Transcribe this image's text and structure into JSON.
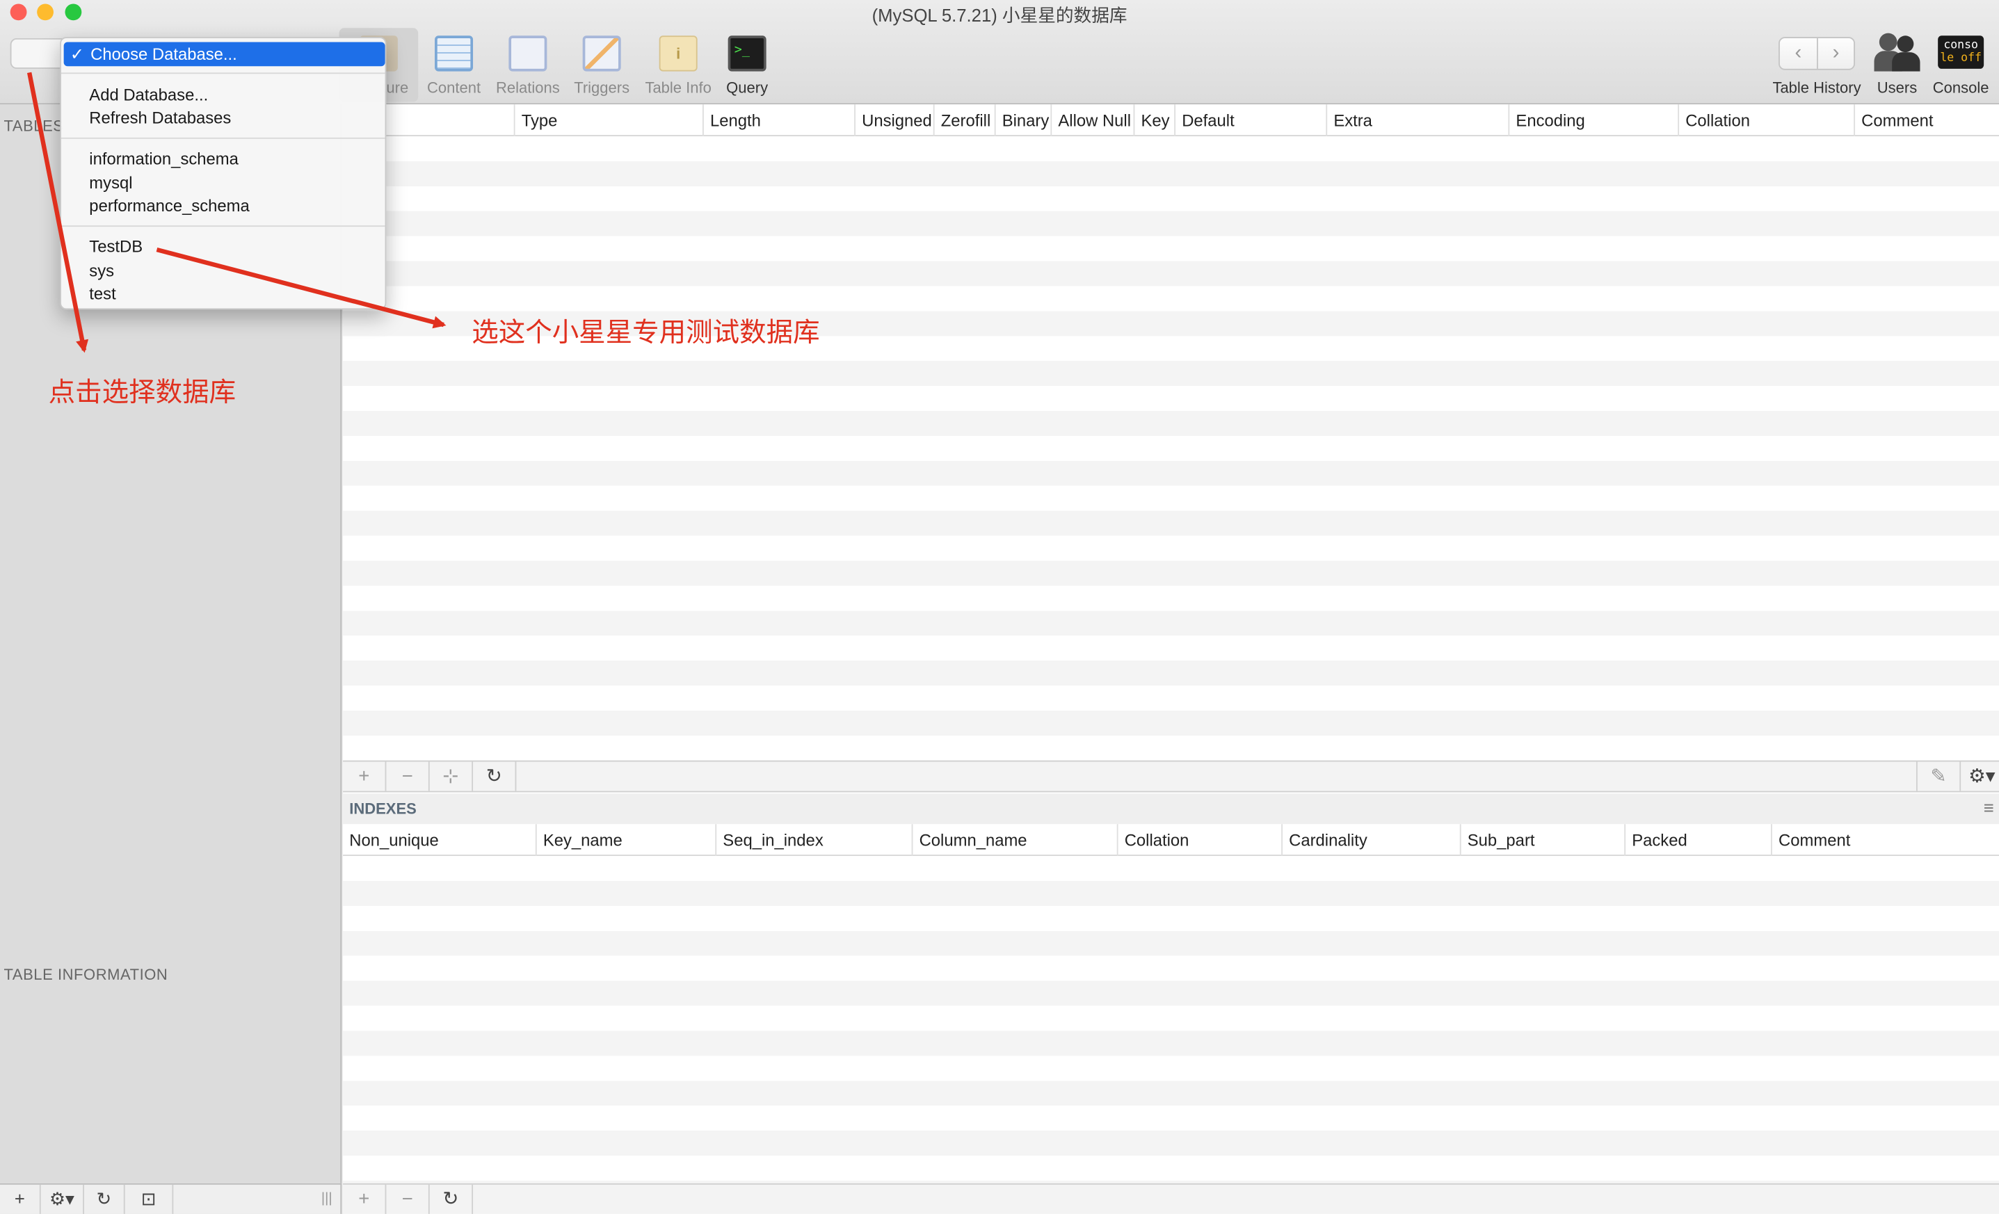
{
  "window": {
    "title": "(MySQL 5.7.21) 小星星的数据库"
  },
  "toolbar": {
    "items": [
      {
        "label": "Structure",
        "visible": "ture"
      },
      {
        "label": "Content"
      },
      {
        "label": "Relations"
      },
      {
        "label": "Triggers"
      },
      {
        "label": "Table Info"
      },
      {
        "label": "Query"
      }
    ],
    "right": [
      {
        "label": "Table History"
      },
      {
        "label": "Users"
      },
      {
        "label": "Console"
      }
    ],
    "console_icon_text": [
      "conso",
      "le off"
    ]
  },
  "db_menu": {
    "selected": "Choose Database...",
    "check": "✓",
    "actions": [
      "Add Database...",
      "Refresh Databases"
    ],
    "system_dbs": [
      "information_schema",
      "mysql",
      "performance_schema"
    ],
    "user_dbs": [
      "TestDB",
      "sys",
      "test"
    ]
  },
  "sidebar": {
    "tables_header": "TABLES",
    "info_header": "TABLE INFORMATION"
  },
  "structure": {
    "columns": [
      "Type",
      "Length",
      "Unsigned",
      "Zerofill",
      "Binary",
      "Allow Null",
      "Key",
      "Default",
      "Extra",
      "Encoding",
      "Collation",
      "Comment"
    ]
  },
  "indexes": {
    "title": "INDEXES",
    "columns": [
      "Non_unique",
      "Key_name",
      "Seq_in_index",
      "Column_name",
      "Collation",
      "Cardinality",
      "Sub_part",
      "Packed",
      "Comment"
    ]
  },
  "annotations": {
    "click_choose": "点击选择数据库",
    "choose_test": "选这个小星星专用测试数据库"
  },
  "colors": {
    "accent": "#1e6fe8",
    "annotation": "#e0301e"
  }
}
